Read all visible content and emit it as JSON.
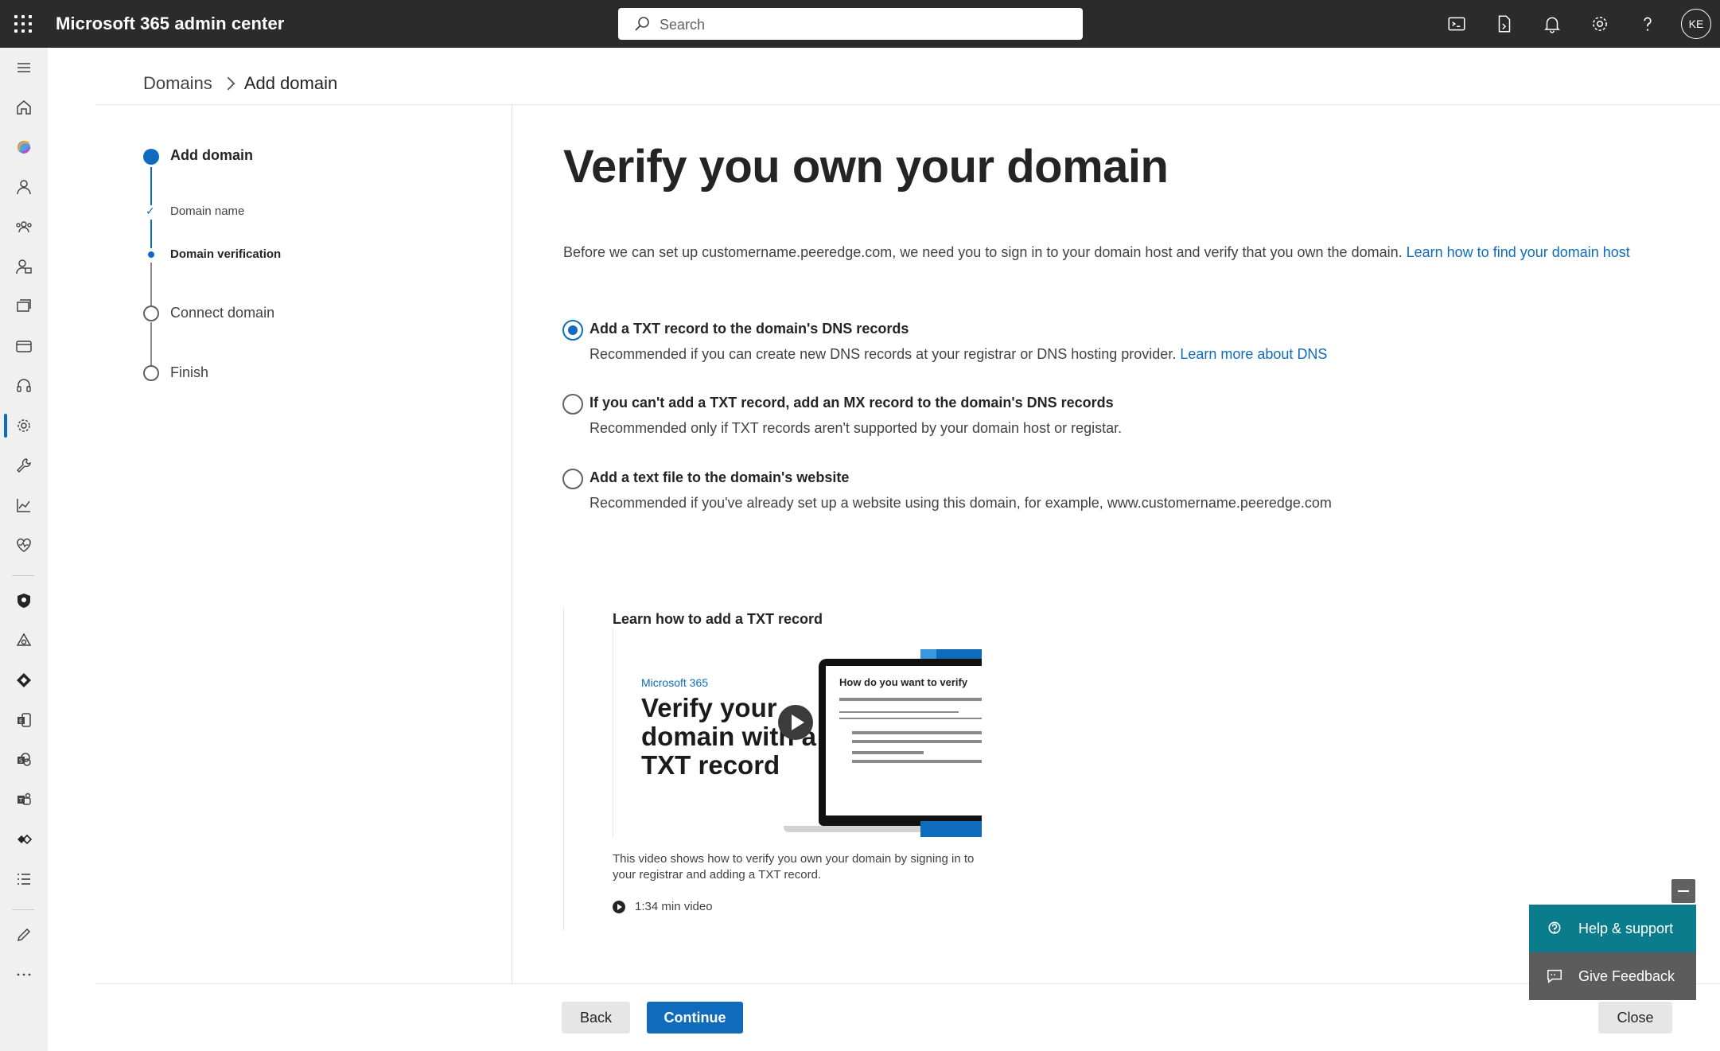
{
  "app": {
    "title": "Microsoft 365 admin center"
  },
  "search": {
    "placeholder": "Search"
  },
  "user": {
    "initials": "KE"
  },
  "breadcrumb": {
    "parent": "Domains",
    "current": "Add domain"
  },
  "stepper": {
    "add_domain": "Add domain",
    "domain_name": "Domain name",
    "domain_verification": "Domain verification",
    "connect_domain": "Connect domain",
    "finish": "Finish"
  },
  "main": {
    "title": "Verify you own your domain",
    "intro": "Before we can set up customername.peeredge.com, we need you to sign in to your domain host and verify that you own the domain.",
    "intro_link": "Learn how to find your domain host",
    "options": [
      {
        "title": "Add a TXT record to the domain's DNS records",
        "desc": "Recommended if you can create new DNS records at your registrar or DNS hosting provider.",
        "link": "Learn more about DNS",
        "checked": true
      },
      {
        "title": "If you can't add a TXT record, add an MX record to the domain's DNS records",
        "desc": "Recommended only if TXT records aren't supported by your domain host or registar.",
        "checked": false
      },
      {
        "title": "Add a text file to the domain's website",
        "desc": "Recommended if you've already set up a website using this domain, for example, www.customername.peeredge.com",
        "checked": false
      }
    ],
    "video": {
      "heading": "Learn how to add a TXT record",
      "brand": "Microsoft 365",
      "thumb_title": "Verify your domain with a TXT record",
      "screen_title": "How do you want to verify",
      "description": "This video shows how to verify you own your domain by signing in to your registrar and adding a TXT record.",
      "length": "1:34 min video"
    }
  },
  "footer": {
    "back": "Back",
    "continue": "Continue",
    "close": "Close"
  },
  "help": {
    "support": "Help & support",
    "feedback": "Give Feedback"
  },
  "colors": {
    "accent": "#0f6cbd",
    "topbar": "#2b2b2b",
    "help_teal": "#0a7c8c"
  }
}
